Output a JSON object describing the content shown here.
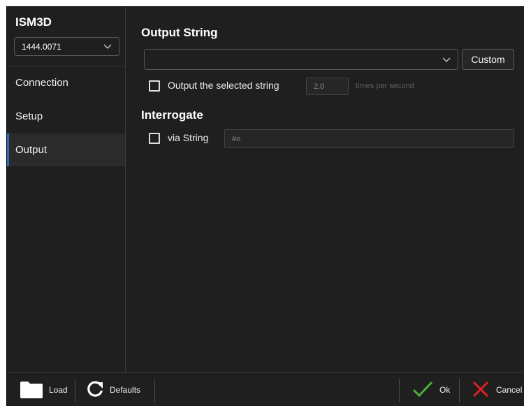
{
  "sidebar": {
    "device_title": "ISM3D",
    "device_select_value": "1444.0071",
    "items": [
      {
        "label": "Connection"
      },
      {
        "label": "Setup"
      },
      {
        "label": "Output"
      }
    ],
    "active_item": "Output"
  },
  "output_string": {
    "title": "Output String",
    "combo_value": "",
    "custom_label": "Custom",
    "checkbox_label": "Output the selected string",
    "checkbox_checked": false,
    "rate_value": "2.0",
    "rate_unit": "times per second"
  },
  "interrogate": {
    "title": "Interrogate",
    "checkbox_label": "via String",
    "checkbox_checked": false,
    "string_value": "#o"
  },
  "footer": {
    "load_label": "Load",
    "defaults_label": "Defaults",
    "ok_label": "Ok",
    "cancel_label": "Cancel"
  },
  "colors": {
    "background": "#1f1f1f",
    "accent": "#2f6cc4",
    "ok": "#4caf3a",
    "cancel": "#e02020"
  }
}
